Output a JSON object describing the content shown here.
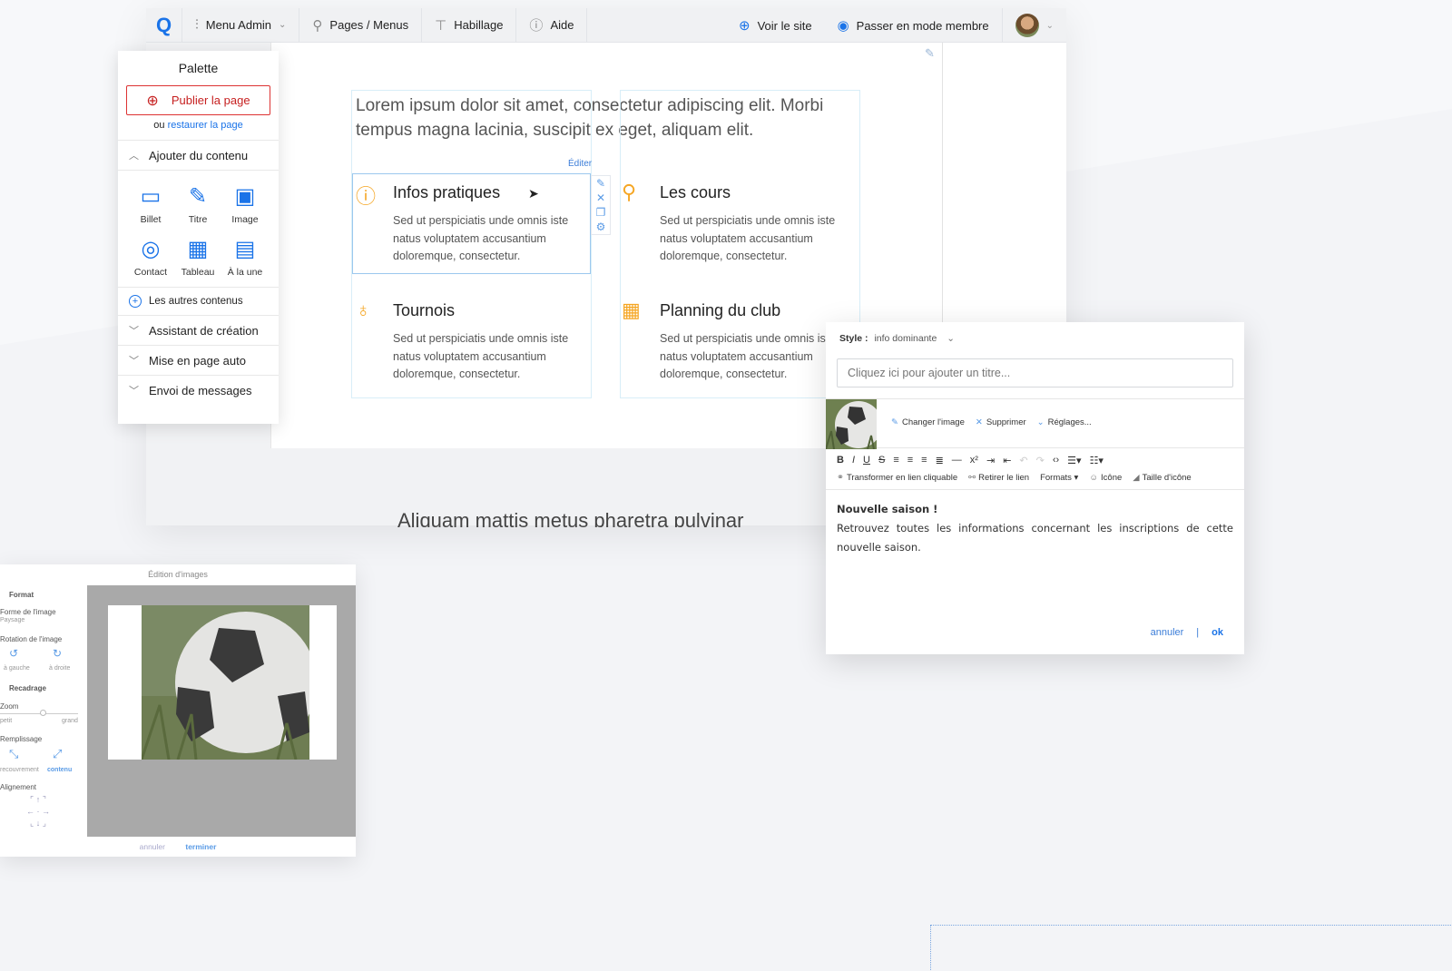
{
  "topbar": {
    "logo": "Q",
    "menu_admin": "Menu Admin",
    "pages_menus": "Pages / Menus",
    "habillage": "Habillage",
    "aide": "Aide",
    "voir_site": "Voir le site",
    "mode_membre": "Passer en mode membre"
  },
  "palette": {
    "title": "Palette",
    "publish": "Publier la page",
    "restore_prefix": "ou",
    "restore_link": "restaurer la page",
    "add_content": "Ajouter du contenu",
    "tiles": [
      {
        "label": "Billet",
        "icon": "billet-icon"
      },
      {
        "label": "Titre",
        "icon": "titre-icon"
      },
      {
        "label": "Image",
        "icon": "image-icon"
      },
      {
        "label": "Contact",
        "icon": "contact-icon"
      },
      {
        "label": "Tableau",
        "icon": "tableau-icon"
      },
      {
        "label": "À la une",
        "icon": "a-la-une-icon"
      }
    ],
    "others": "Les autres contenus",
    "sections": [
      "Assistant de création",
      "Mise en page auto",
      "Envoi de messages"
    ]
  },
  "page": {
    "intro": "Lorem ipsum dolor sit amet, consectetur adipiscing elit. Morbi tempus magna lacinia, suscipit ex eget, aliquam elit.",
    "edit_label": "Éditer",
    "blocks": [
      {
        "title": "Infos pratiques",
        "text": "Sed ut perspiciatis unde omnis iste natus voluptatem accusantium doloremque, consectetur.",
        "icon": "info-icon"
      },
      {
        "title": "Les cours",
        "text": "Sed ut perspiciatis unde omnis iste natus voluptatem accusantium doloremque, consectetur.",
        "icon": "search-icon"
      },
      {
        "title": "Tournois",
        "text": "Sed ut perspiciatis unde omnis iste natus voluptatem accusantium doloremque, consectetur.",
        "icon": "medal-icon"
      },
      {
        "title": "Planning du club",
        "text": "Sed ut perspiciatis unde omnis iste natus voluptatem accusantium doloremque, consectetur.",
        "icon": "calendar-icon"
      }
    ],
    "bottom_heading": "Aliquam mattis metus pharetra pulvinar"
  },
  "image_editor": {
    "title": "Édition d'images",
    "format": "Format",
    "shape_label": "Forme de l'image",
    "shape_value": "Paysage",
    "rotation": "Rotation de l'image",
    "rotate_left": "à gauche",
    "rotate_right": "à droite",
    "cropping": "Recadrage",
    "zoom": "Zoom",
    "zoom_min": "petit",
    "zoom_max": "grand",
    "fill": "Remplissage",
    "fill_cover": "recouvrement",
    "fill_contain": "contenu",
    "alignment": "Alignement",
    "cancel": "annuler",
    "done": "terminer"
  },
  "text_dialog": {
    "style_label": "Style :",
    "style_value": "info dominante",
    "title_placeholder": "Cliquez ici pour ajouter un titre...",
    "change_image": "Changer l'image",
    "delete": "Supprimer",
    "settings": "Réglages...",
    "link": "Transformer en lien cliquable",
    "unlink": "Retirer le lien",
    "formats": "Formats",
    "icon": "Icône",
    "icon_size": "Taille d'icône",
    "body_heading": "Nouvelle saison !",
    "body_text": "Retrouvez toutes les informations concernant les inscriptions de cette nouvelle saison.",
    "cancel": "annuler",
    "separator": "|",
    "ok": "ok"
  },
  "colors": {
    "accent": "#1a73e8",
    "publish_red": "#c62020",
    "block_icon_orange": "#f5a623"
  }
}
